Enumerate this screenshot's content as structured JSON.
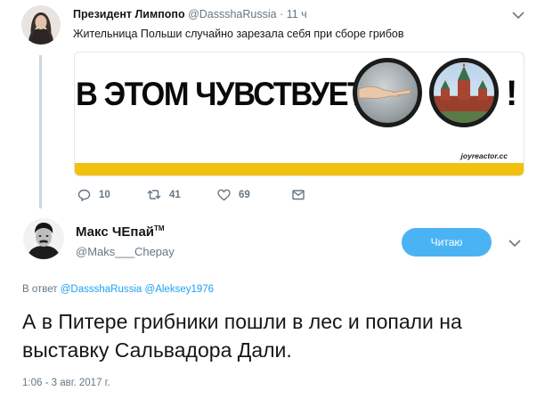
{
  "parent_tweet": {
    "author_name": "Президент Лимпопо",
    "author_handle": "@DassshaRussia",
    "time": "11 ч",
    "text": "Жительница Польши случайно зарезала себя при сборе грибов",
    "media": {
      "headline": "В ЭТОМ ЧУВСТВУЕТСЯ",
      "exclamation": "!",
      "credit": "joyreactor.cc"
    },
    "actions": {
      "replies": "10",
      "retweets": "41",
      "likes": "69"
    }
  },
  "main_tweet": {
    "author_name": "Макс ЧЕпай",
    "author_name_suffix": "TM",
    "author_handle": "@Maks___Chepay",
    "follow_label": "Читаю",
    "reply_prefix": "В ответ",
    "reply_mentions": [
      "@DassshaRussia",
      "@Aleksey1976"
    ],
    "text": "А в Питере грибники пошли в лес и попали на выставку Сальвадора Дали.",
    "timestamp": "1:06 - 3 авг. 2017 г."
  },
  "colors": {
    "accent": "#1da1f2",
    "follow_button": "#4ab3f4",
    "muted": "#657786",
    "thread_line": "#ccd6dd",
    "media_strip": "#f2c10d"
  },
  "icons": [
    "chevron-down-icon",
    "reply-icon",
    "retweet-icon",
    "like-icon",
    "message-icon"
  ]
}
